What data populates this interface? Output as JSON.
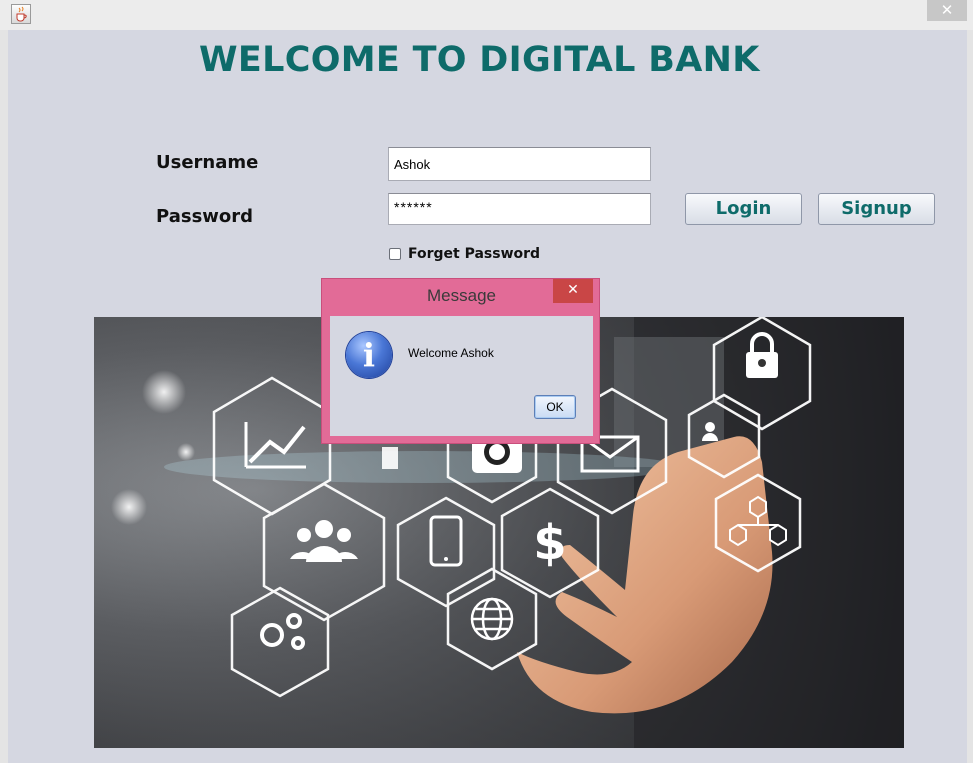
{
  "window": {
    "icon": "java-cup-icon",
    "close_label": "✕"
  },
  "page": {
    "heading": "WELCOME TO DIGITAL BANK"
  },
  "form": {
    "username_label": "Username",
    "username_value": "Ashok",
    "password_label": "Password",
    "password_value": "******",
    "forget_password_label": "Forget Password",
    "forget_password_checked": false,
    "login_label": "Login",
    "signup_label": "Signup"
  },
  "hero": {
    "icons": [
      "lock-icon",
      "chart-icon",
      "bulb-icon",
      "camera-icon",
      "mail-icon",
      "person-icon",
      "group-icon",
      "tablet-icon",
      "dollar-icon",
      "network-icon",
      "gears-icon",
      "globe-icon"
    ]
  },
  "dialog": {
    "title": "Message",
    "close_label": "✕",
    "icon": "info-icon",
    "message": "Welcome Ashok",
    "ok_label": "OK"
  },
  "colors": {
    "accent": "#0e6b6a",
    "frame": "#d5d7e1",
    "dialog_border": "#e26b97",
    "dialog_close": "#c94646"
  }
}
